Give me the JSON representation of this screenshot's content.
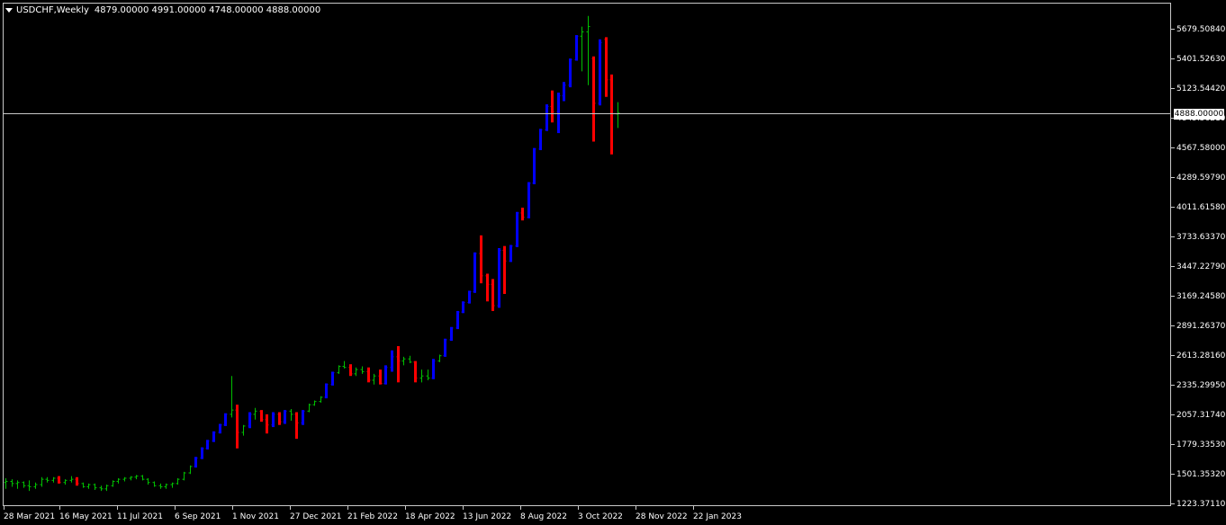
{
  "header": {
    "symbol": "USDCHF,Weekly",
    "ohlc": "4879.00000 4991.00000 4748.00000 4888.00000"
  },
  "current_price_label": "4888.00000",
  "colors": {
    "background": "#000000",
    "grid_frame": "#c8c8c8",
    "bull_bar": "#00c000",
    "bear_bar": "#ff0000",
    "trend_bar": "#0000ff",
    "price_line": "#c8c8c8",
    "axis_text": "#ffffff"
  },
  "chart_data": {
    "type": "ohlc",
    "title": "USDCHF,Weekly",
    "y_tick_labels": [
      "5679.50840",
      "5401.52630",
      "5123.54420",
      "4845.56210",
      "4567.58000",
      "4289.59790",
      "4011.61580",
      "3733.63370",
      "3447.22790",
      "3169.24580",
      "2891.26370",
      "2613.28160",
      "2335.29950",
      "2057.31740",
      "1779.33530",
      "1501.35320",
      "1223.37110"
    ],
    "x_tick_labels": [
      "28 Mar 2021",
      "16 May 2021",
      "11 Jul 2021",
      "6 Sep 2021",
      "1 Nov 2021",
      "27 Dec 2021",
      "21 Feb 2022",
      "18 Apr 2022",
      "13 Jun 2022",
      "8 Aug 2022",
      "3 Oct 2022",
      "28 Nov 2022",
      "22 Jan 2023"
    ],
    "ylim": [
      1223.3711,
      5679.5084
    ],
    "current_price": 4888.0,
    "bars": [
      {
        "o": 1420,
        "h": 1460,
        "l": 1360,
        "c": 1430
      },
      {
        "o": 1430,
        "h": 1450,
        "l": 1380,
        "c": 1410
      },
      {
        "o": 1410,
        "h": 1440,
        "l": 1360,
        "c": 1420
      },
      {
        "o": 1420,
        "h": 1430,
        "l": 1370,
        "c": 1390
      },
      {
        "o": 1390,
        "h": 1440,
        "l": 1340,
        "c": 1380
      },
      {
        "o": 1380,
        "h": 1420,
        "l": 1360,
        "c": 1400
      },
      {
        "o": 1400,
        "h": 1470,
        "l": 1380,
        "c": 1450
      },
      {
        "o": 1450,
        "h": 1470,
        "l": 1420,
        "c": 1440
      },
      {
        "o": 1440,
        "h": 1470,
        "l": 1420,
        "c": 1460
      },
      {
        "o": 1460,
        "h": 1480,
        "l": 1410,
        "c": 1420
      },
      {
        "o": 1420,
        "h": 1450,
        "l": 1400,
        "c": 1440
      },
      {
        "o": 1440,
        "h": 1480,
        "l": 1420,
        "c": 1450
      },
      {
        "o": 1450,
        "h": 1470,
        "l": 1390,
        "c": 1410
      },
      {
        "o": 1410,
        "h": 1420,
        "l": 1370,
        "c": 1380
      },
      {
        "o": 1380,
        "h": 1410,
        "l": 1360,
        "c": 1400
      },
      {
        "o": 1400,
        "h": 1410,
        "l": 1350,
        "c": 1370
      },
      {
        "o": 1370,
        "h": 1390,
        "l": 1340,
        "c": 1360
      },
      {
        "o": 1360,
        "h": 1400,
        "l": 1340,
        "c": 1390
      },
      {
        "o": 1390,
        "h": 1440,
        "l": 1380,
        "c": 1430
      },
      {
        "o": 1430,
        "h": 1460,
        "l": 1410,
        "c": 1450
      },
      {
        "o": 1450,
        "h": 1470,
        "l": 1430,
        "c": 1460
      },
      {
        "o": 1460,
        "h": 1480,
        "l": 1440,
        "c": 1470
      },
      {
        "o": 1470,
        "h": 1490,
        "l": 1450,
        "c": 1480
      },
      {
        "o": 1480,
        "h": 1490,
        "l": 1440,
        "c": 1450
      },
      {
        "o": 1450,
        "h": 1460,
        "l": 1400,
        "c": 1420
      },
      {
        "o": 1420,
        "h": 1430,
        "l": 1380,
        "c": 1390
      },
      {
        "o": 1390,
        "h": 1410,
        "l": 1360,
        "c": 1380
      },
      {
        "o": 1380,
        "h": 1410,
        "l": 1360,
        "c": 1400
      },
      {
        "o": 1400,
        "h": 1420,
        "l": 1370,
        "c": 1410
      },
      {
        "o": 1410,
        "h": 1460,
        "l": 1400,
        "c": 1450
      },
      {
        "o": 1450,
        "h": 1520,
        "l": 1440,
        "c": 1510
      },
      {
        "o": 1510,
        "h": 1580,
        "l": 1500,
        "c": 1570
      },
      {
        "o": 1570,
        "h": 1660,
        "l": 1560,
        "c": 1650
      },
      {
        "o": 1650,
        "h": 1750,
        "l": 1640,
        "c": 1740
      },
      {
        "o": 1740,
        "h": 1820,
        "l": 1730,
        "c": 1810
      },
      {
        "o": 1810,
        "h": 1900,
        "l": 1800,
        "c": 1890
      },
      {
        "o": 1890,
        "h": 1970,
        "l": 1880,
        "c": 1960
      },
      {
        "o": 1960,
        "h": 2070,
        "l": 1950,
        "c": 2060
      },
      {
        "o": 2060,
        "h": 2420,
        "l": 2030,
        "c": 2100
      },
      {
        "o": 2100,
        "h": 2150,
        "l": 1740,
        "c": 1890
      },
      {
        "o": 1890,
        "h": 1960,
        "l": 1860,
        "c": 1950
      },
      {
        "o": 1950,
        "h": 2080,
        "l": 1930,
        "c": 2060
      },
      {
        "o": 2060,
        "h": 2120,
        "l": 2010,
        "c": 2090
      },
      {
        "o": 2090,
        "h": 2100,
        "l": 1990,
        "c": 2010
      },
      {
        "o": 2010,
        "h": 2060,
        "l": 1880,
        "c": 1960
      },
      {
        "o": 1960,
        "h": 2080,
        "l": 1940,
        "c": 2060
      },
      {
        "o": 2060,
        "h": 2080,
        "l": 1960,
        "c": 1990
      },
      {
        "o": 1990,
        "h": 2100,
        "l": 1970,
        "c": 2090
      },
      {
        "o": 2090,
        "h": 2110,
        "l": 2000,
        "c": 2060
      },
      {
        "o": 2060,
        "h": 2080,
        "l": 1830,
        "c": 1980
      },
      {
        "o": 1980,
        "h": 2100,
        "l": 1960,
        "c": 2090
      },
      {
        "o": 2090,
        "h": 2160,
        "l": 2080,
        "c": 2150
      },
      {
        "o": 2150,
        "h": 2190,
        "l": 2140,
        "c": 2180
      },
      {
        "o": 2180,
        "h": 2230,
        "l": 2170,
        "c": 2220
      },
      {
        "o": 2220,
        "h": 2350,
        "l": 2210,
        "c": 2340
      },
      {
        "o": 2340,
        "h": 2460,
        "l": 2330,
        "c": 2450
      },
      {
        "o": 2450,
        "h": 2520,
        "l": 2440,
        "c": 2510
      },
      {
        "o": 2510,
        "h": 2560,
        "l": 2490,
        "c": 2500
      },
      {
        "o": 2500,
        "h": 2530,
        "l": 2420,
        "c": 2440
      },
      {
        "o": 2440,
        "h": 2500,
        "l": 2420,
        "c": 2480
      },
      {
        "o": 2480,
        "h": 2510,
        "l": 2440,
        "c": 2460
      },
      {
        "o": 2460,
        "h": 2500,
        "l": 2360,
        "c": 2380
      },
      {
        "o": 2380,
        "h": 2440,
        "l": 2340,
        "c": 2420
      },
      {
        "o": 2420,
        "h": 2480,
        "l": 2340,
        "c": 2350
      },
      {
        "o": 2350,
        "h": 2520,
        "l": 2340,
        "c": 2500
      },
      {
        "o": 2500,
        "h": 2660,
        "l": 2460,
        "c": 2600
      },
      {
        "o": 2600,
        "h": 2700,
        "l": 2360,
        "c": 2560
      },
      {
        "o": 2560,
        "h": 2600,
        "l": 2520,
        "c": 2580
      },
      {
        "o": 2580,
        "h": 2610,
        "l": 2540,
        "c": 2550
      },
      {
        "o": 2550,
        "h": 2560,
        "l": 2360,
        "c": 2400
      },
      {
        "o": 2400,
        "h": 2480,
        "l": 2360,
        "c": 2420
      },
      {
        "o": 2420,
        "h": 2480,
        "l": 2380,
        "c": 2400
      },
      {
        "o": 2400,
        "h": 2580,
        "l": 2390,
        "c": 2560
      },
      {
        "o": 2560,
        "h": 2620,
        "l": 2550,
        "c": 2610
      },
      {
        "o": 2610,
        "h": 2770,
        "l": 2600,
        "c": 2760
      },
      {
        "o": 2760,
        "h": 2880,
        "l": 2750,
        "c": 2870
      },
      {
        "o": 2870,
        "h": 3030,
        "l": 2860,
        "c": 3020
      },
      {
        "o": 3020,
        "h": 3120,
        "l": 3010,
        "c": 3110
      },
      {
        "o": 3110,
        "h": 3220,
        "l": 3100,
        "c": 3210
      },
      {
        "o": 3210,
        "h": 3580,
        "l": 3200,
        "c": 3570
      },
      {
        "o": 3570,
        "h": 3740,
        "l": 3290,
        "c": 3360
      },
      {
        "o": 3360,
        "h": 3380,
        "l": 3120,
        "c": 3280
      },
      {
        "o": 3280,
        "h": 3330,
        "l": 3030,
        "c": 3080
      },
      {
        "o": 3080,
        "h": 3620,
        "l": 3060,
        "c": 3600
      },
      {
        "o": 3600,
        "h": 3640,
        "l": 3190,
        "c": 3500
      },
      {
        "o": 3500,
        "h": 3650,
        "l": 3490,
        "c": 3640
      },
      {
        "o": 3640,
        "h": 3960,
        "l": 3630,
        "c": 3950
      },
      {
        "o": 3950,
        "h": 4000,
        "l": 3880,
        "c": 3910
      },
      {
        "o": 3910,
        "h": 4240,
        "l": 3900,
        "c": 4230
      },
      {
        "o": 4230,
        "h": 4560,
        "l": 4220,
        "c": 4550
      },
      {
        "o": 4550,
        "h": 4740,
        "l": 4540,
        "c": 4730
      },
      {
        "o": 4730,
        "h": 4970,
        "l": 4720,
        "c": 4950
      },
      {
        "o": 4950,
        "h": 5100,
        "l": 4800,
        "c": 4900
      },
      {
        "o": 4900,
        "h": 5080,
        "l": 4700,
        "c": 5050
      },
      {
        "o": 5050,
        "h": 5180,
        "l": 5000,
        "c": 5150
      },
      {
        "o": 5150,
        "h": 5400,
        "l": 5130,
        "c": 5390
      },
      {
        "o": 5390,
        "h": 5620,
        "l": 5380,
        "c": 5610
      },
      {
        "o": 5610,
        "h": 5700,
        "l": 5280,
        "c": 5650
      },
      {
        "o": 5650,
        "h": 5800,
        "l": 5150,
        "c": 5700
      },
      {
        "o": 5400,
        "h": 5420,
        "l": 4620,
        "c": 4980
      },
      {
        "o": 4980,
        "h": 5580,
        "l": 4960,
        "c": 5550
      },
      {
        "o": 5580,
        "h": 5600,
        "l": 5040,
        "c": 5200
      },
      {
        "o": 5200,
        "h": 5250,
        "l": 4500,
        "c": 4880
      },
      {
        "o": 4879,
        "h": 4991,
        "l": 4748,
        "c": 4888
      }
    ]
  }
}
